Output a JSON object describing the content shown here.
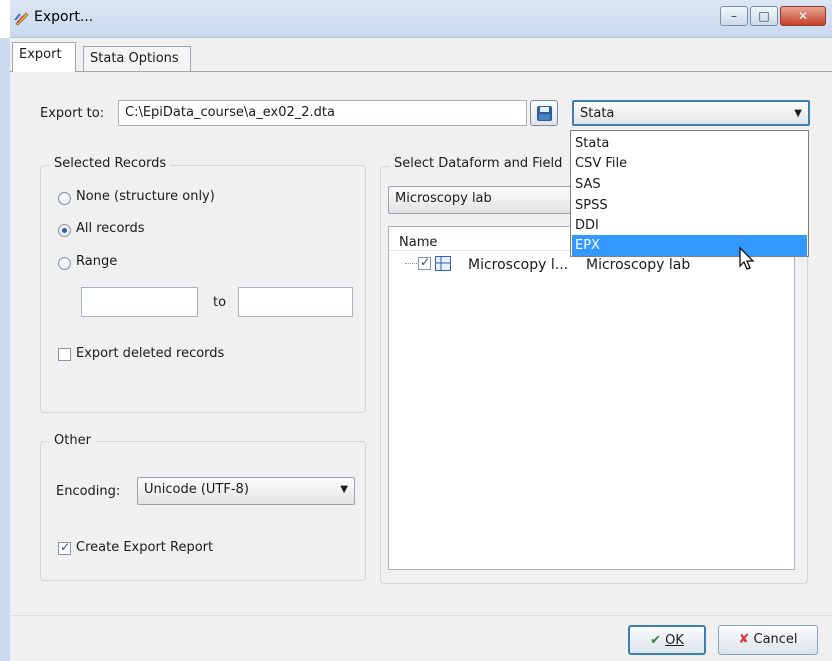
{
  "window": {
    "title": "Export...",
    "buttons": {
      "minimize": "–",
      "maximize": "□",
      "close": "✕"
    }
  },
  "tabs": [
    {
      "label": "Export",
      "active": true
    },
    {
      "label": "Stata Options",
      "active": false
    }
  ],
  "export_to": {
    "label": "Export to:",
    "path": "C:\\EpiData_course\\a_ex02_2.dta",
    "format_selected": "Stata",
    "format_options": [
      "Stata",
      "CSV File",
      "SAS",
      "SPSS",
      "DDI",
      "EPX"
    ],
    "highlighted_option": "EPX"
  },
  "selected_records": {
    "legend": "Selected Records",
    "options": [
      "None (structure only)",
      "All records",
      "Range"
    ],
    "selected": "All records",
    "range_from": "",
    "range_to_label": "to",
    "range_to": "",
    "export_deleted_label": "Export deleted records",
    "export_deleted_checked": false
  },
  "other": {
    "legend": "Other",
    "encoding_label": "Encoding:",
    "encoding_value": "Unicode (UTF-8)",
    "create_report_label": "Create Export Report",
    "create_report_checked": true
  },
  "dataform": {
    "legend": "Select Dataform and Field",
    "combo_value": "Microscopy lab",
    "columns": [
      "Name"
    ],
    "tree_items": [
      {
        "name": "Microscopy l...",
        "caption": "Microscopy lab",
        "checked": true
      }
    ]
  },
  "footer": {
    "ok_label": "OK",
    "cancel_label": "Cancel"
  },
  "colors": {
    "titlebar": "#c9d9ee",
    "selection": "#3399ff",
    "panel_bg": "#f0f0f0"
  }
}
